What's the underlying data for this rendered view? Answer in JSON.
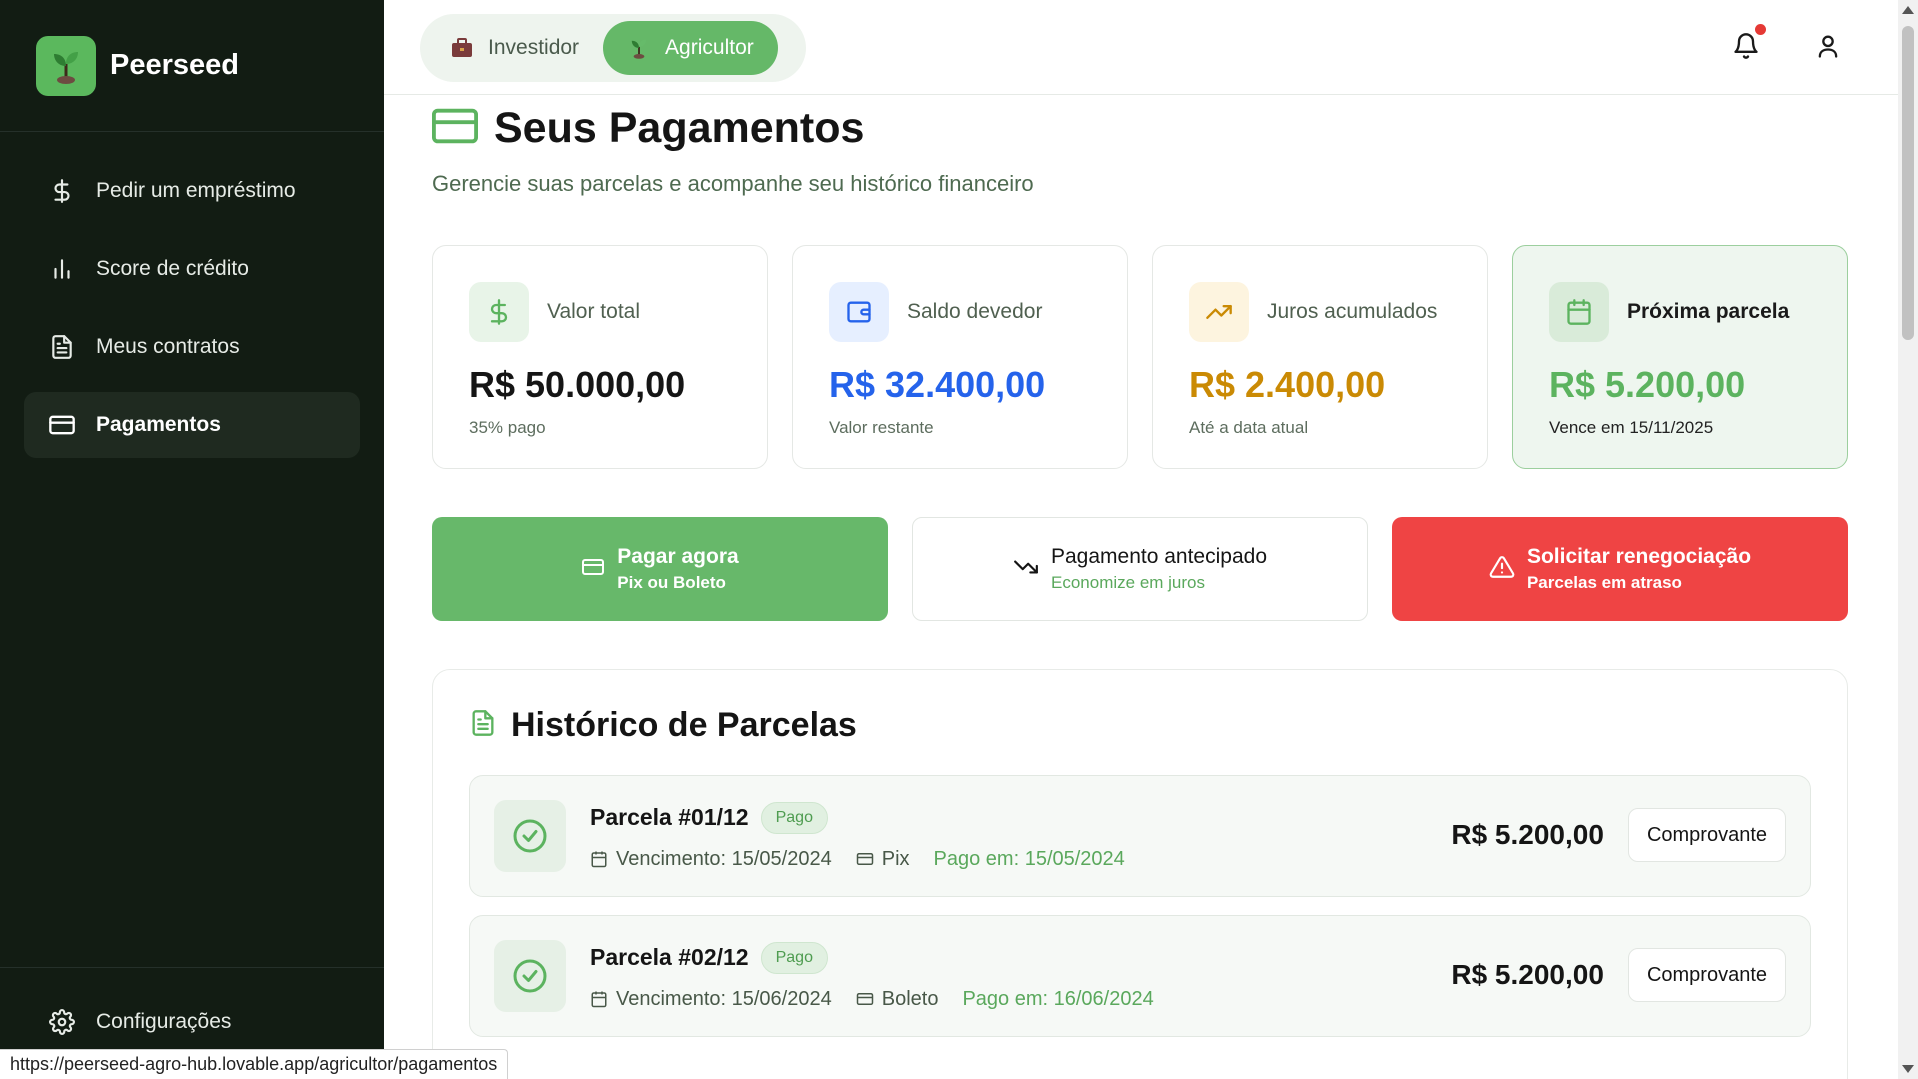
{
  "brand": {
    "name": "Peerseed"
  },
  "sidebar": {
    "items": [
      {
        "label": "Pedir um empréstimo",
        "icon": "dollar-icon"
      },
      {
        "label": "Score de crédito",
        "icon": "bar-chart-icon"
      },
      {
        "label": "Meus contratos",
        "icon": "document-icon"
      },
      {
        "label": "Pagamentos",
        "icon": "credit-card-icon",
        "active": true
      }
    ],
    "settings_label": "Configurações"
  },
  "topbar": {
    "toggle": {
      "investor_label": "Investidor",
      "farmer_label": "Agricultor",
      "active": "Agricultor"
    }
  },
  "page": {
    "title": "Seus Pagamentos",
    "subtitle": "Gerencie suas parcelas e acompanhe seu histórico financeiro"
  },
  "cards": [
    {
      "label": "Valor total",
      "value": "R$ 50.000,00",
      "note": "35% pago",
      "value_color": "#151515",
      "icon": "dollar-icon"
    },
    {
      "label": "Saldo devedor",
      "value": "R$ 32.400,00",
      "note": "Valor restante",
      "value_color": "#2563eb",
      "icon": "wallet-icon"
    },
    {
      "label": "Juros acumulados",
      "value": "R$ 2.400,00",
      "note": "Até a data atual",
      "value_color": "#ca8a04",
      "icon": "trending-up-icon"
    },
    {
      "label": "Próxima parcela",
      "value": "R$ 5.200,00",
      "note": "Vence em 15/11/2025",
      "value_color": "#5cb35f",
      "icon": "calendar-icon"
    }
  ],
  "actions": [
    {
      "title": "Pagar agora",
      "sub": "Pix ou Boleto"
    },
    {
      "title": "Pagamento antecipado",
      "sub": "Economize em juros"
    },
    {
      "title": "Solicitar renegociação",
      "sub": "Parcelas em atraso"
    }
  ],
  "history": {
    "title": "Histórico de Parcelas",
    "rows": [
      {
        "title": "Parcela #01/12",
        "status": "Pago",
        "due": "Vencimento: 15/05/2024",
        "method": "Pix",
        "paid": "Pago em: 15/05/2024",
        "amount": "R$ 5.200,00",
        "button": "Comprovante"
      },
      {
        "title": "Parcela #02/12",
        "status": "Pago",
        "due": "Vencimento: 15/06/2024",
        "method": "Boleto",
        "paid": "Pago em: 16/06/2024",
        "amount": "R$ 5.200,00",
        "button": "Comprovante"
      }
    ]
  },
  "status_url": "https://peerseed-agro-hub.lovable.app/agricultor/pagamentos",
  "colors": {
    "accent": "#65b868",
    "danger": "#ef4444",
    "sidebar_bg": "#121c13"
  }
}
